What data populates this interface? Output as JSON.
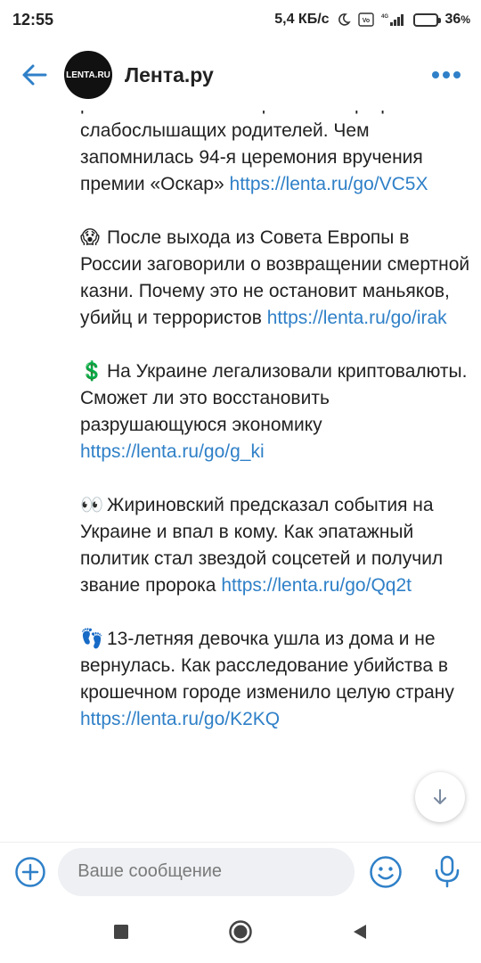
{
  "status_bar": {
    "time": "12:55",
    "network_speed": "5,4 КБ/с",
    "battery": "36",
    "battery_level": 0.36,
    "icons": [
      "moon-icon",
      "volte-icon",
      "4g-icon",
      "signal-icon",
      "battery-icon"
    ]
  },
  "header": {
    "avatar_text": "LENTA.RU",
    "title": "Лента.ру",
    "icons": [
      "back-arrow-icon",
      "more-dots-icon"
    ]
  },
  "post": {
    "items": [
      {
        "emoji": "",
        "text": "рейтинги и главный фильм — про ребёнка слабослышащих родителей. Чем запомнилась 94-я церемония вручения премии «Оскар»",
        "link": "https://lenta.ru/go/VC5X"
      },
      {
        "emoji": "😱",
        "text": "После выхода из Совета Европы в России заговорили о возвращении смертной казни. Почему это не остановит маньяков, убийц и террористов",
        "link": "https://lenta.ru/go/irak"
      },
      {
        "emoji": "💲",
        "text": "На Украине легализовали криптовалюты. Сможет ли это восстановить разрушающуюся экономику",
        "link": "https://lenta.ru/go/g_ki"
      },
      {
        "emoji": "👀",
        "text": "Жириновский предсказал события на Украине и впал в кому. Как эпатажный политик стал звездой соцсетей и получил звание пророка",
        "link": "https://lenta.ru/go/Qq2t"
      },
      {
        "emoji": "👣",
        "text": "13-летняя девочка ушла из дома и не вернулась. Как расследование убийства в крошечном городе изменило целую страну",
        "link": "https://lenta.ru/go/K2KQ"
      }
    ]
  },
  "composer": {
    "placeholder": "Ваше сообщение",
    "icons": [
      "add-icon",
      "emoji-icon",
      "microphone-icon"
    ]
  },
  "colors": {
    "accent": "#2f80c8",
    "link": "#2f80c8"
  }
}
